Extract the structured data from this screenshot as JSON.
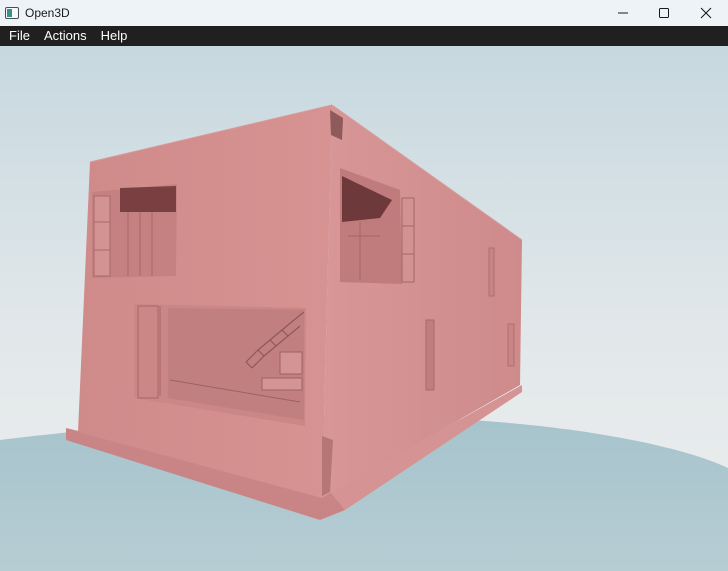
{
  "window": {
    "title": "Open3D",
    "icon": "open3d-app-icon",
    "controls": [
      "minimize-icon",
      "maximize-icon",
      "close-icon"
    ]
  },
  "menubar": {
    "items": [
      {
        "label": "File"
      },
      {
        "label": "Actions"
      },
      {
        "label": "Help"
      }
    ]
  },
  "scene": {
    "model": "two-storey house mesh",
    "model_color": "#d38a8a",
    "sky_color": "#dde6ea",
    "ground_color": "#a9c6cf"
  }
}
